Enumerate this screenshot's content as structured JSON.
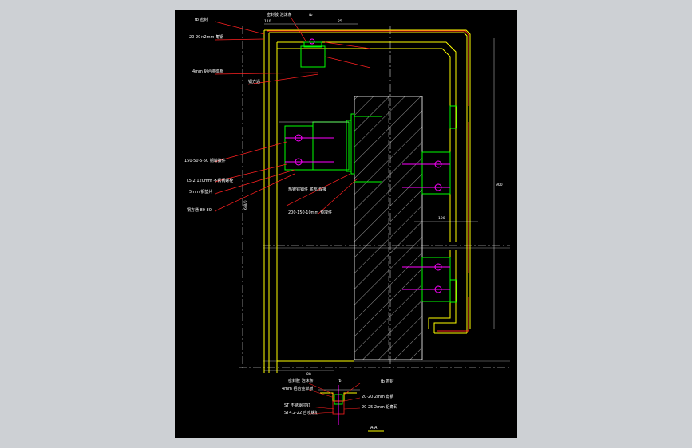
{
  "colors": {
    "background": "#000000",
    "frame": "#cdd0d4",
    "leader": "#ff2020",
    "profile": "#ffff00",
    "bracket": "#00ff00",
    "bolt": "#ff00ff",
    "concrete": "#ffffff",
    "label": "#ffffff"
  },
  "labels": {
    "top_left": [
      "fb 密封",
      "20·20×2mm 角钢",
      "4mm 铝合金单板",
      "钢方通"
    ],
    "mid_left": [
      "150·50·5·50 钢转接件",
      "L5·2·120mm 不锈钢螺栓",
      "5mm 钢垫片",
      "钢方通 80·80"
    ],
    "mid_center": [
      "热镀锌钢件 底部 焊接",
      "200·150·10mm 预埋件"
    ],
    "top_center": [
      "密封胶 泡沫条",
      "110"
    ],
    "bottom_left": [
      "密封胶 泡沫条",
      "4mm 铝合金单板",
      "ST 不锈钢拉钉",
      "ST4.2·22 自攻螺钉"
    ],
    "bottom_right": [
      "fb 密封",
      "20·20·2mm 角钢",
      "20·25·2mm 铝角码"
    ],
    "section_title": "A-A"
  },
  "dimensions": {
    "top_110": "110",
    "top_25": "25",
    "top_fb": "fb",
    "right_span": "900",
    "right_100": "100",
    "bottom_80": "80",
    "bottom_fb": "fb",
    "left_span": "6/8/0"
  }
}
